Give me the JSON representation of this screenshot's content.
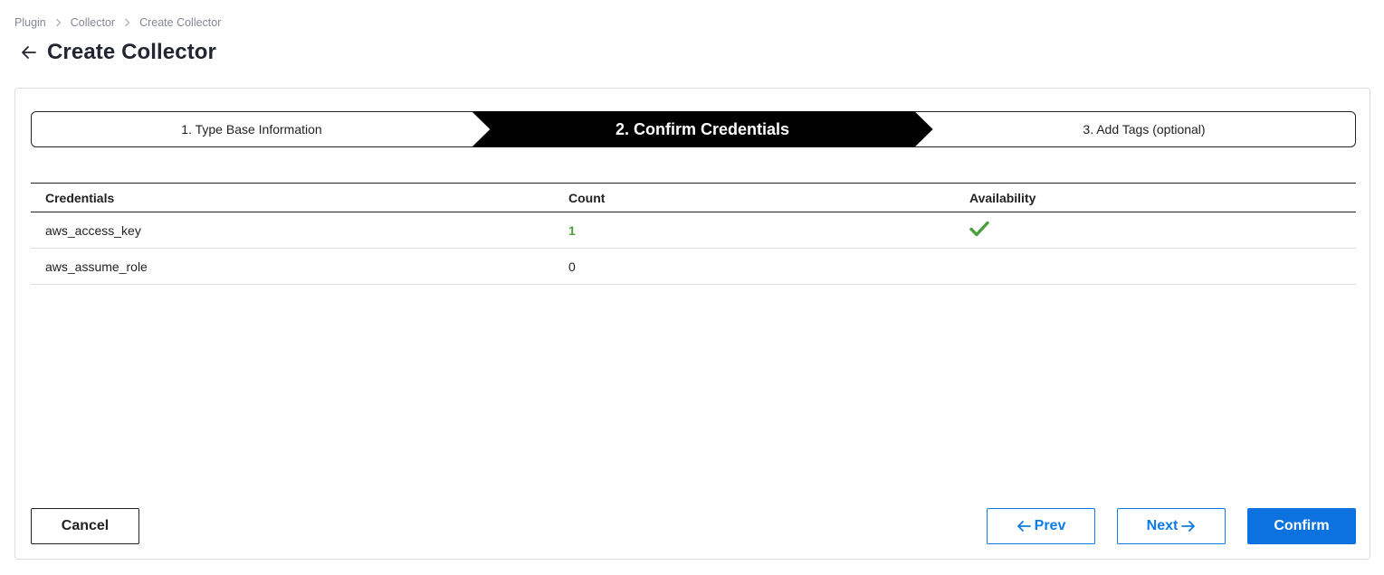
{
  "breadcrumb": {
    "items": [
      "Plugin",
      "Collector",
      "Create Collector"
    ],
    "separator_icon": "chevron-right-icon"
  },
  "header": {
    "back_icon": "arrow-left-icon",
    "title": "Create Collector"
  },
  "steps": [
    {
      "label": "1. Type Base Information",
      "active": false
    },
    {
      "label": "2. Confirm Credentials",
      "active": true
    },
    {
      "label": "3. Add Tags (optional)",
      "active": false
    }
  ],
  "table": {
    "columns": [
      "Credentials",
      "Count",
      "Availability"
    ],
    "rows": [
      {
        "credential": "aws_access_key",
        "count": "1",
        "available": true
      },
      {
        "credential": "aws_assume_role",
        "count": "0",
        "available": false
      }
    ],
    "availability_icon": "checkmark-icon"
  },
  "buttons": {
    "cancel": "Cancel",
    "prev": "Prev",
    "next": "Next",
    "confirm": "Confirm"
  },
  "colors": {
    "primary_blue": "#0c72e0",
    "success_green": "#4ba13c",
    "active_step_bg": "#000000"
  }
}
